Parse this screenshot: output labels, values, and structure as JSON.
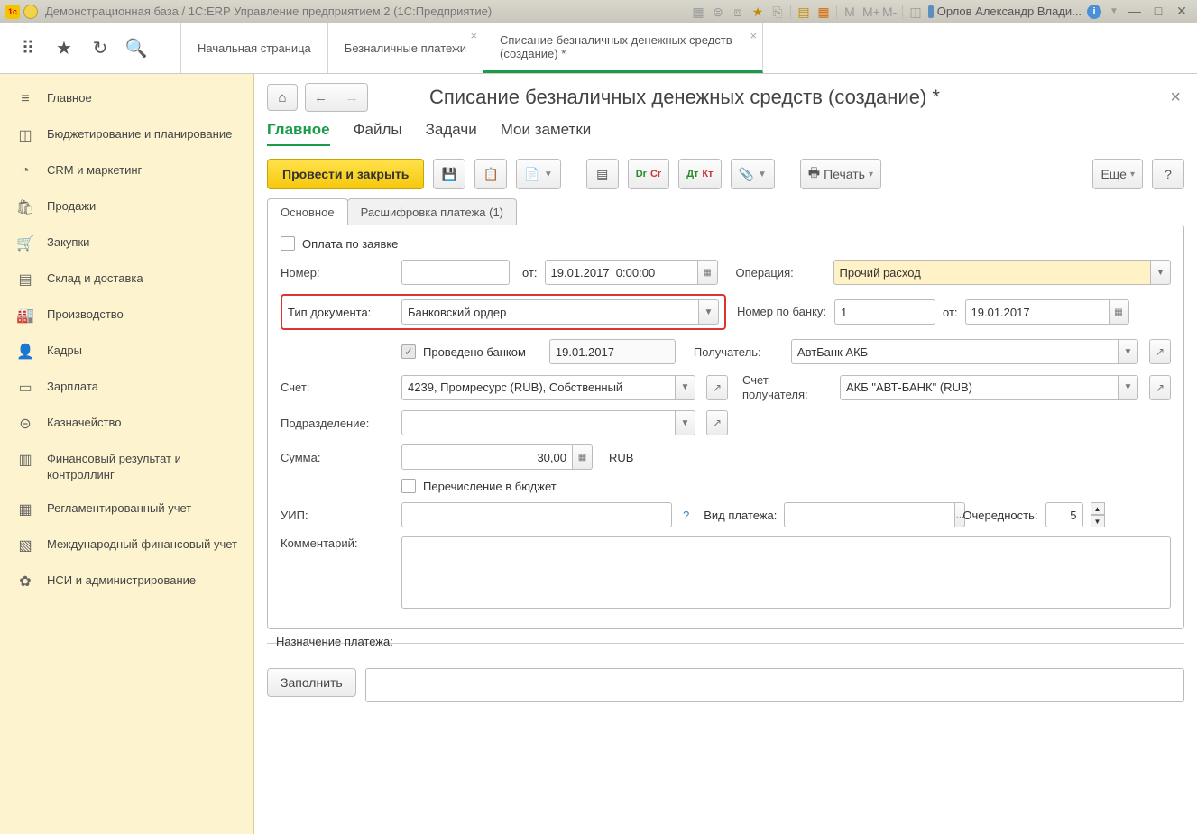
{
  "titlebar": {
    "title": "Демонстрационная база / 1С:ERP Управление предприятием 2  (1С:Предприятие)",
    "user": "Орлов Александр Влади...",
    "letters": [
      "M",
      "M+",
      "M-"
    ]
  },
  "top_tabs": [
    {
      "label": "Начальная страница",
      "closable": false
    },
    {
      "label": "Безналичные платежи",
      "closable": true
    },
    {
      "label": "Списание безналичных денежных средств (создание) *",
      "closable": true,
      "active": true
    }
  ],
  "sidebar": [
    {
      "icon": "≡",
      "label": "Главное"
    },
    {
      "icon": "◫",
      "label": "Бюджетирование и планирование"
    },
    {
      "icon": "◔",
      "label": "CRM и маркетинг"
    },
    {
      "icon": "🛍",
      "label": "Продажи"
    },
    {
      "icon": "🛒",
      "label": "Закупки"
    },
    {
      "icon": "▤",
      "label": "Склад и доставка"
    },
    {
      "icon": "🏭",
      "label": "Производство"
    },
    {
      "icon": "👤",
      "label": "Кадры"
    },
    {
      "icon": "▭",
      "label": "Зарплата"
    },
    {
      "icon": "⊝",
      "label": "Казначейство"
    },
    {
      "icon": "▥",
      "label": "Финансовый результат и контроллинг"
    },
    {
      "icon": "▦",
      "label": "Регламентированный учет"
    },
    {
      "icon": "▧",
      "label": "Международный финансовый учет"
    },
    {
      "icon": "✿",
      "label": "НСИ и администрирование"
    }
  ],
  "page": {
    "title": "Списание безналичных денежных средств (создание) *",
    "section_tabs": [
      "Главное",
      "Файлы",
      "Задачи",
      "Мои заметки"
    ],
    "active_section": 0,
    "toolbar": {
      "primary": "Провести и закрыть",
      "print": "Печать",
      "more": "Еще",
      "help": "?"
    },
    "inner_tabs": [
      "Основное",
      "Расшифровка платежа (1)"
    ],
    "active_inner": 0,
    "form": {
      "pay_by_request_label": "Оплата по заявке",
      "pay_by_request": false,
      "number_label": "Номер:",
      "number": "",
      "from_label": "от:",
      "date": "19.01.2017  0:00:00",
      "operation_label": "Операция:",
      "operation": "Прочий расход",
      "doc_type_label": "Тип документа:",
      "doc_type": "Банковский ордер",
      "bank_number_label": "Номер по банку:",
      "bank_number": "1",
      "bank_from_label": "от:",
      "bank_date": "19.01.2017",
      "bank_processed_label": "Проведено банком",
      "bank_processed": true,
      "bank_processed_date": "19.01.2017",
      "recipient_label": "Получатель:",
      "recipient": "АвтБанк АКБ",
      "account_label": "Счет:",
      "account": "4239, Промресурс (RUB), Собственный",
      "recipient_account_label": "Счет получателя:",
      "recipient_account": "АКБ \"АВТ-БАНК\" (RUB)",
      "division_label": "Подразделение:",
      "division": "",
      "sum_label": "Сумма:",
      "sum": "30,00",
      "currency": "RUB",
      "budget_transfer_label": "Перечисление в бюджет",
      "budget_transfer": false,
      "uip_label": "УИП:",
      "uip": "",
      "payment_type_label": "Вид платежа:",
      "payment_type": "",
      "priority_label": "Очередность:",
      "priority": "5",
      "comment_label": "Комментарий:",
      "comment": "",
      "purpose_label": "Назначение платежа:",
      "fill_btn": "Заполнить",
      "purpose": ""
    }
  }
}
